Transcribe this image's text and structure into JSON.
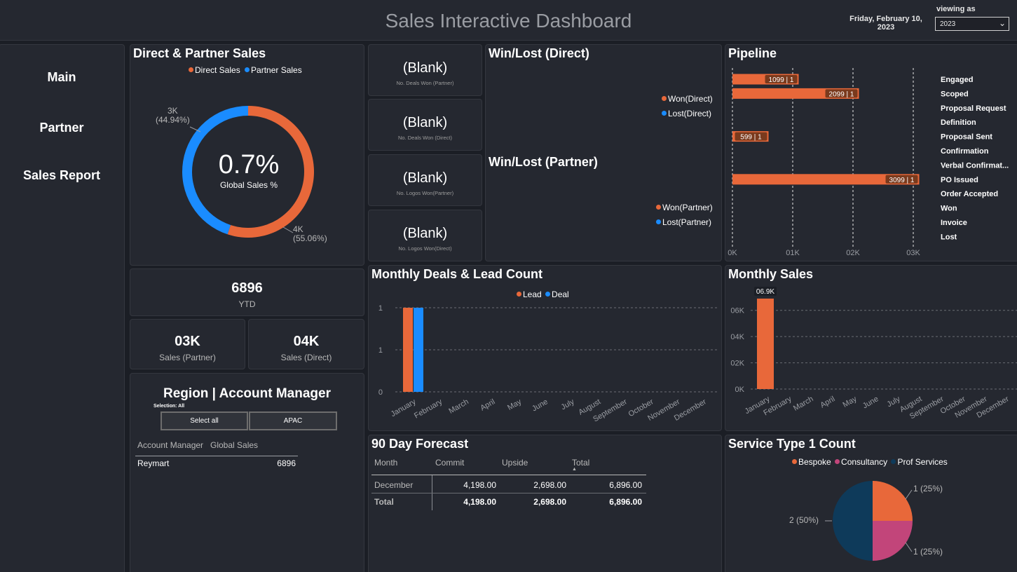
{
  "header": {
    "title": "Sales Interactive Dashboard",
    "date_line1": "Friday, February 10,",
    "date_line2": "2023",
    "viewing_label": "viewing as",
    "viewing_value": "2023"
  },
  "nav": {
    "items": [
      "Main",
      "Partner",
      "Sales Report"
    ]
  },
  "direct_partner": {
    "title": "Direct & Partner Sales",
    "legend": [
      "Direct Sales",
      "Partner Sales"
    ],
    "center_value": "0.7%",
    "center_label": "Global Sales %",
    "partner_label": "3K",
    "partner_pct": "(44.94%)",
    "direct_label": "4K",
    "direct_pct": "(55.06%)",
    "chart_data": {
      "type": "pie",
      "categories": [
        "Direct Sales",
        "Partner Sales"
      ],
      "values": [
        55.06,
        44.94
      ],
      "colors": [
        "#e8683a",
        "#1a8cff"
      ]
    }
  },
  "kpis": {
    "ytd_value": "6896",
    "ytd_label": "YTD",
    "partner_value": "03K",
    "partner_label": "Sales (Partner)",
    "direct_value": "04K",
    "direct_label": "Sales (Direct)"
  },
  "blank_cards": [
    {
      "value": "(Blank)",
      "label": "No. Deals Won (Partner)"
    },
    {
      "value": "(Blank)",
      "label": "No. Deals Won (Direct)"
    },
    {
      "value": "(Blank)",
      "label": "No. Logos Won(Partner)"
    },
    {
      "value": "(Blank)",
      "label": "No. Logos Won(Direct)"
    }
  ],
  "winlost": {
    "direct_title": "Win/Lost (Direct)",
    "direct_legend": [
      "Won(Direct)",
      "Lost(Direct)"
    ],
    "partner_title": "Win/Lost (Partner)",
    "partner_legend": [
      "Won(Partner)",
      "Lost(Partner)"
    ]
  },
  "pipeline": {
    "title": "Pipeline",
    "stages": [
      "Engaged",
      "Scoped",
      "Proposal Request",
      "Definition",
      "Proposal Sent",
      "Confirmation",
      "Verbal Confirmat...",
      "PO Issued",
      "Order Accepted",
      "Won",
      "Invoice",
      "Lost"
    ],
    "x_ticks": [
      "0K",
      "01K",
      "02K",
      "03K"
    ],
    "chart_data": {
      "type": "bar",
      "orientation": "horizontal",
      "categories": [
        "Engaged",
        "Scoped",
        "Proposal Request",
        "Definition",
        "Proposal Sent",
        "Confirmation",
        "Verbal Confirmat...",
        "PO Issued",
        "Order Accepted",
        "Won",
        "Invoice",
        "Lost"
      ],
      "values": [
        1099,
        2099,
        0,
        0,
        599,
        0,
        0,
        3099,
        0,
        0,
        0,
        0
      ],
      "data_labels": [
        "1099 | 1",
        "2099 | 1",
        "",
        "",
        "599 | 1",
        "",
        "",
        "3099 | 1",
        "",
        "",
        "",
        ""
      ],
      "xlim": [
        0,
        3000
      ],
      "color": "#e8683a"
    }
  },
  "region": {
    "title": "Region | Account Manager",
    "selection": "Selection: All",
    "buttons": [
      "Select all",
      "APAC"
    ],
    "col_headers": [
      "Account Manager",
      "Global Sales"
    ],
    "rows": [
      {
        "name": "Reymart",
        "value": "6896"
      }
    ]
  },
  "monthly_deals": {
    "title": "Monthly Deals & Lead Count",
    "legend": [
      "Lead",
      "Deal"
    ],
    "y_ticks": [
      "1",
      "1",
      "0"
    ],
    "chart_data": {
      "type": "bar",
      "categories": [
        "January",
        "February",
        "March",
        "April",
        "May",
        "June",
        "July",
        "August",
        "September",
        "October",
        "November",
        "December"
      ],
      "series": [
        {
          "name": "Lead",
          "values": [
            1,
            0,
            0,
            0,
            0,
            0,
            0,
            0,
            0,
            0,
            0,
            0
          ],
          "color": "#e8683a"
        },
        {
          "name": "Deal",
          "values": [
            1,
            0,
            0,
            0,
            0,
            0,
            0,
            0,
            0,
            0,
            0,
            0
          ],
          "color": "#1a8cff"
        }
      ],
      "ylim": [
        0,
        1
      ],
      "grid": true
    }
  },
  "monthly_sales": {
    "title": "Monthly Sales",
    "y_ticks": [
      "06K",
      "04K",
      "02K",
      "0K"
    ],
    "chart_data": {
      "type": "bar",
      "categories": [
        "January",
        "February",
        "March",
        "April",
        "May",
        "June",
        "July",
        "August",
        "September",
        "October",
        "November",
        "December"
      ],
      "values": [
        6896,
        0,
        0,
        0,
        0,
        0,
        0,
        0,
        0,
        0,
        0,
        0
      ],
      "data_labels": [
        "06.9K"
      ],
      "ylim": [
        0,
        7000
      ],
      "color": "#e8683a",
      "grid": true
    }
  },
  "forecast": {
    "title": "90 Day Forecast",
    "headers": [
      "Month",
      "Commit",
      "Upside",
      "Total"
    ],
    "rows": [
      [
        "December",
        "4,198.00",
        "2,698.00",
        "6,896.00"
      ],
      [
        "Total",
        "4,198.00",
        "2,698.00",
        "6,896.00"
      ]
    ]
  },
  "service": {
    "title": "Service Type 1 Count",
    "legend": [
      "Bespoke",
      "Consultancy",
      "Prof Services"
    ],
    "labels": [
      "1 (25%)",
      "1 (25%)",
      "2 (50%)"
    ],
    "chart_data": {
      "type": "pie",
      "categories": [
        "Bespoke",
        "Consultancy",
        "Prof Services"
      ],
      "values": [
        1,
        1,
        2
      ],
      "colors": [
        "#e8683a",
        "#c2457a",
        "#0e3a5a"
      ]
    }
  }
}
